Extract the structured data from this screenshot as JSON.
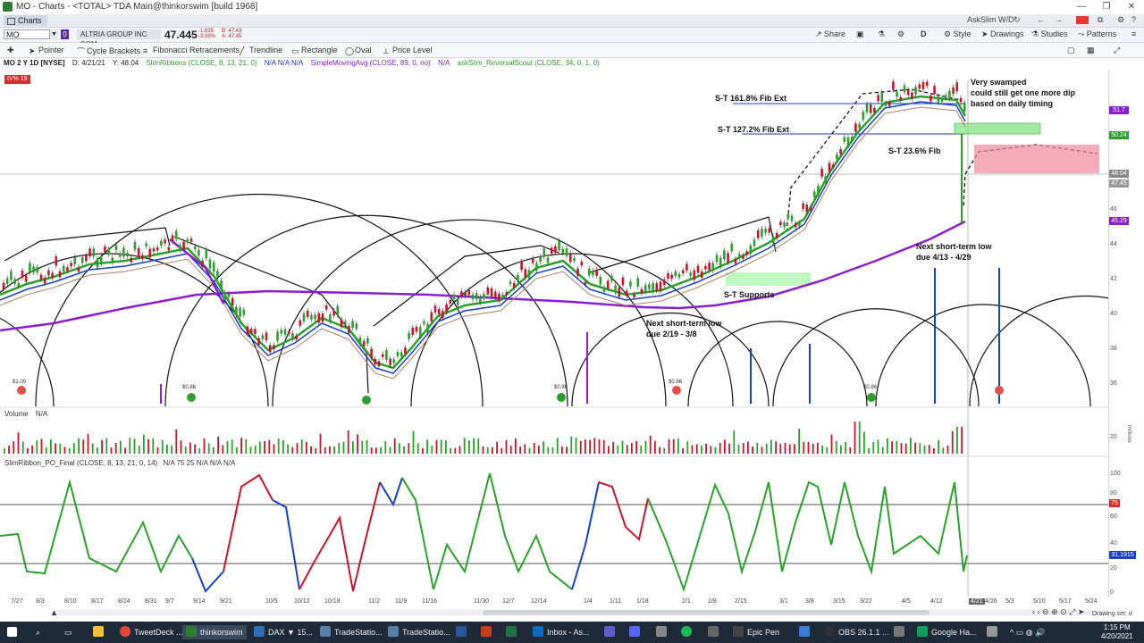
{
  "window": {
    "title": "MO - Charts - <TOTAL> TDA Main@thinkorswim [build 1968]"
  },
  "tab": {
    "label": "Charts"
  },
  "top_right": {
    "askslim": "AskSlim W/D"
  },
  "symbol": {
    "value": "MO",
    "company": "ALTRIA GROUP INC COM",
    "price": "47.445",
    "change_line1": "-1.635",
    "change_line2": "-3.33%",
    "bid": "B: 47.43",
    "ask": "A: 47.45"
  },
  "header_buttons": {
    "share": "Share",
    "style": "Style",
    "drawings": "Drawings",
    "studies": "Studies",
    "patterns": "Patterns",
    "d_label": "D"
  },
  "tools": {
    "pointer": "Pointer",
    "cycle": "Cycle Brackets",
    "fib": "Fibonacci Retracements",
    "trendline": "Trendline",
    "rectangle": "Rectangle",
    "oval": "Oval",
    "pricelevel": "Price Level"
  },
  "study_line": {
    "header": "MO 2 Y 1D [NYSE]",
    "date": "D: 4/21/21",
    "y": "Y: 48.04",
    "s1": "SlimRibbons (CLOSE, 8, 13, 21, 0)",
    "s1v": "N/A  N/A  N/A",
    "s2": "SimpleMovingAvg (CLOSE, 89, 0, no)",
    "s2v": "N/A",
    "s3": "askSlim_ReversalScout (CLOSE, 34, 0, 1, 0)"
  },
  "iv_badge": "IV% 19",
  "annotations": {
    "fib161": "S-T 161.8% Fib Ext",
    "fib127": "S-T 127.2% Fib Ext",
    "fib236": "S-T 23.6% Fib",
    "swamped1": "Very swamped",
    "swamped2": "could still get one more dip",
    "swamped3": "based on daily timing",
    "next1a": "Next short-term low",
    "next1b": "due 4/13 - 4/29",
    "next2a": "Next short-term low",
    "next2b": "due 2/19 - 3/8",
    "supports": "S-T Supports"
  },
  "dividends": [
    "$1.09",
    "$0.86",
    "$0.86",
    "$0.86",
    "$0.86"
  ],
  "price_axis": [
    "40",
    "42",
    "44",
    "46",
    "36",
    "38"
  ],
  "price_tags": {
    "p517": "51.7",
    "p5024": "50.24",
    "p4804": "48.04",
    "p4745": "47.45",
    "p4529": "45.29"
  },
  "volume_label": "Volume",
  "volume_na": "N/A",
  "volume_axis": {
    "v20": "20",
    "units": "millions"
  },
  "osc": {
    "label": "SlimRibbon_PO_Final (CLOSE, 8, 13, 21, 0, 14)",
    "vals": "N/A  75  25  N/A  N/A  N/A",
    "axis": [
      "100",
      "80",
      "60",
      "40",
      "20",
      "0"
    ],
    "tag75": "75",
    "tag_cur": "31.1915"
  },
  "date_axis": [
    "7/27",
    "8/3",
    "8/10",
    "8/17",
    "8/24",
    "8/31",
    "9/7",
    "9/14",
    "9/21",
    "10/5",
    "10/12",
    "10/19",
    "11/2",
    "11/9",
    "11/16",
    "11/30",
    "12/7",
    "12/14",
    "1/4",
    "1/11",
    "1/18",
    "2/1",
    "2/8",
    "2/15",
    "3/1",
    "3/8",
    "3/15",
    "3/22",
    "4/5",
    "4/12",
    "4/21",
    "4/26",
    "5/3",
    "5/10",
    "5/17",
    "5/24"
  ],
  "drawing_set": "Drawing set: d",
  "taskbar": {
    "items": [
      "TweetDeck ...",
      "thinkorswim",
      "DAX ▼ 15...",
      "TradeStatio...",
      "TradeStatio...",
      "Inbox - As...",
      "Epic Pen",
      "OBS 26.1.1 ...",
      "Google Ha..."
    ],
    "time": "1:15 PM",
    "date": "4/20/2021"
  },
  "colors": {
    "accent": "#2e7d32",
    "ribbon_green": "#2e9e2e",
    "ribbon_blue": "#1a3fbf",
    "sma_purple": "#8a1ecf",
    "bear_red": "#c0182b"
  }
}
